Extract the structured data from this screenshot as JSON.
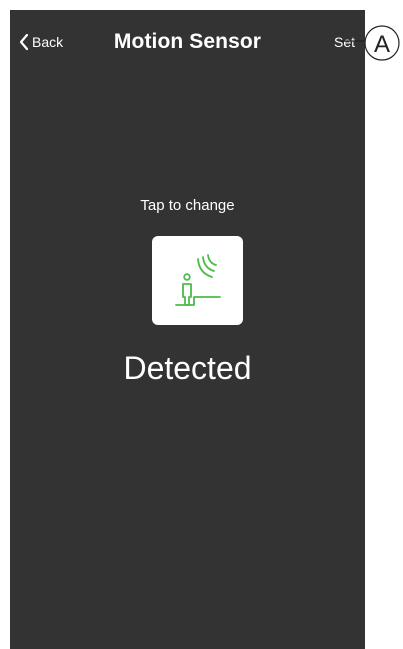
{
  "header": {
    "back_label": "Back",
    "title": "Motion Sensor",
    "set_label": "Set"
  },
  "main": {
    "hint": "Tap to change",
    "state": "Detected",
    "tile_icon": "motion-sensor-person-icon"
  },
  "callout": {
    "letter": "A"
  },
  "colors": {
    "background": "#333333",
    "text": "#ffffff",
    "accent": "#4dbb4a"
  }
}
